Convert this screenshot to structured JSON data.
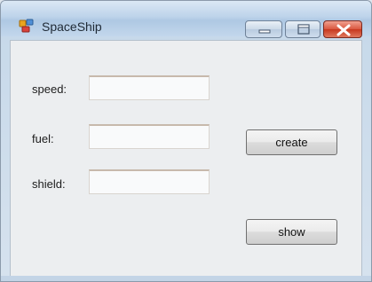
{
  "window": {
    "title": "SpaceShip",
    "controls": {
      "minimize": "minimize-icon",
      "maximize": "maximize-icon",
      "close": "close-icon"
    }
  },
  "form": {
    "fields": [
      {
        "label": "speed:",
        "value": ""
      },
      {
        "label": "fuel:",
        "value": ""
      },
      {
        "label": "shield:",
        "value": ""
      }
    ],
    "buttons": {
      "create": "create",
      "show": "show"
    }
  },
  "colors": {
    "close_button": "#c7381f",
    "client_background": "#eceef0",
    "titlebar": "#bdd3ea"
  }
}
